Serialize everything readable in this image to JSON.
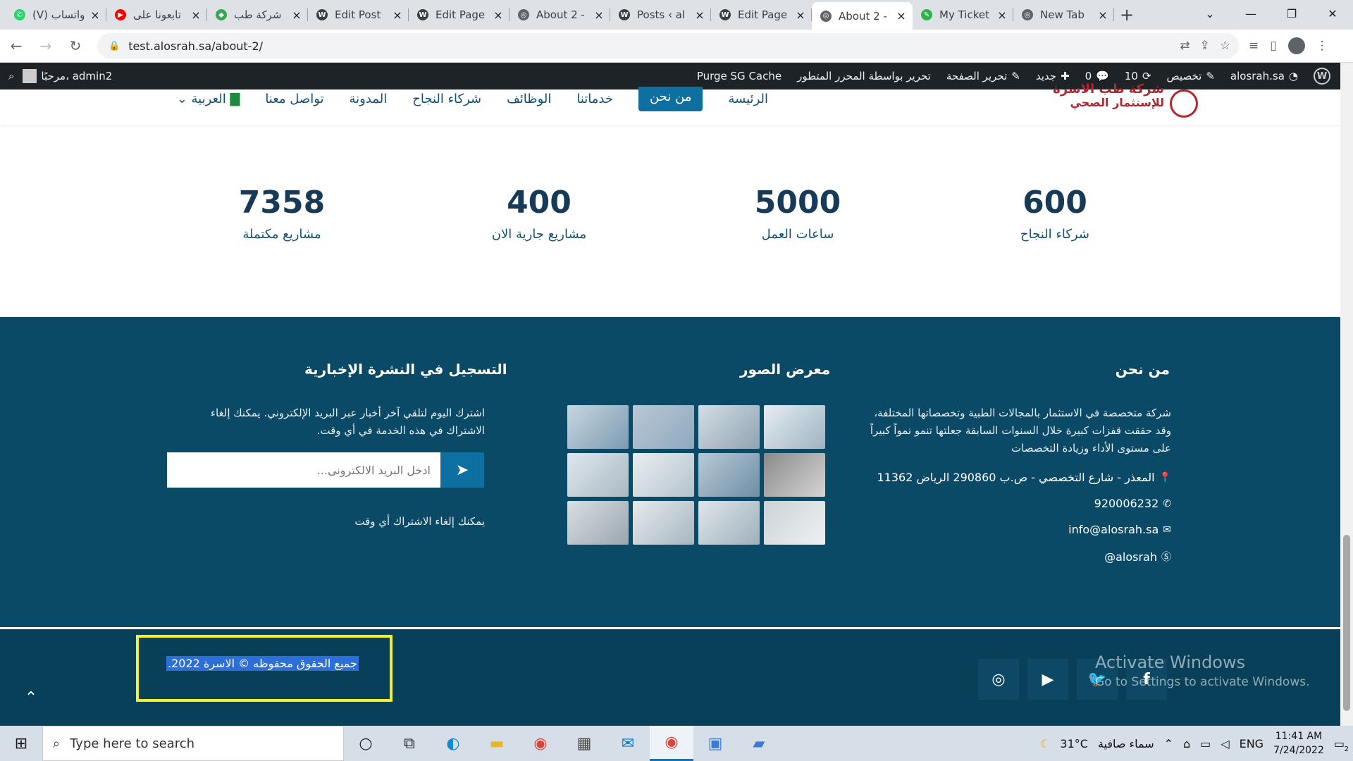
{
  "browser": {
    "tabs": [
      {
        "title": "(V) واتساب",
        "color": "#25d366",
        "glyph": "✆"
      },
      {
        "title": "تابعونا على",
        "color": "#ff0000",
        "glyph": "▶"
      },
      {
        "title": "شركة طب",
        "color": "#34a853",
        "glyph": "◆"
      },
      {
        "title": "Edit Post",
        "color": "#3c4043",
        "glyph": "W"
      },
      {
        "title": "Edit Page",
        "color": "#3c4043",
        "glyph": "W"
      },
      {
        "title": "About 2 -",
        "color": "#5f6368",
        "glyph": "◎"
      },
      {
        "title": "Posts ‹ al",
        "color": "#3c4043",
        "glyph": "W"
      },
      {
        "title": "Edit Page",
        "color": "#3c4043",
        "glyph": "W"
      },
      {
        "title": "About 2 -",
        "color": "#5f6368",
        "glyph": "◎"
      },
      {
        "title": "My Ticket",
        "color": "#2db34a",
        "glyph": "✎"
      },
      {
        "title": "New Tab",
        "color": "#5f6368",
        "glyph": "◎"
      }
    ],
    "active_tab_index": 8,
    "url": "test.alosrah.sa/about-2/"
  },
  "wp_admin_bar": {
    "site_name": "alosrah.sa",
    "customize": "تخصيص",
    "updates": "10",
    "comments": "0",
    "new": "جديد",
    "edit_page": "تحرير الصفحة",
    "edit_advanced": "تحرير بواسطة المحرر المتطور",
    "purge": "Purge SG Cache",
    "greeting": "مرحبًا، admin2"
  },
  "nav": {
    "items": [
      "الرئيسة",
      "من نحن",
      "خدماتنا",
      "الوظائف",
      "شركاء النجاح",
      "المدونة",
      "تواصل معنا"
    ],
    "active": "من نحن",
    "language": "العربية"
  },
  "stats": [
    {
      "number": "600",
      "label": "شركاء النجاح"
    },
    {
      "number": "5000",
      "label": "ساعات العمل"
    },
    {
      "number": "400",
      "label": "مشاريع جارية الان"
    },
    {
      "number": "7358",
      "label": "مشاريع مكتملة"
    }
  ],
  "footer": {
    "about_title": "من نحن",
    "about_text": "شركة متخصصة في الاستثمار بالمجالات الطبية وتخصصاتها المختلفة، وقد حققت قفزات كبيرة خلال السنوات السابقة جعلتها تنمو نمواً كبيراً على مستوى الأداء وزيادة التخصصات",
    "address": "المعذر - شارع التخصصي - ص.ب 290860 الرياض 11362",
    "phone": "920006232",
    "email": "info@alosrah.sa",
    "skype": "alosrah@",
    "gallery_title": "معرض الصور",
    "newsletter_title": "التسجيل في النشرة الإخبارية",
    "newsletter_text": "اشترك اليوم لتلقي آخر أخبار عبر البريد الإلكتروني. يمكنك إلغاء الاشتراك في هذه الخدمة في أي وقت.",
    "email_placeholder": "ادخل البريد الالكترونى...",
    "unsubscribe_note": "يمكنك إلغاء الاشتراك أي وقت",
    "copyright": "جميع الحقوق محفوظه © الاسرة 2022."
  },
  "windows_watermark": {
    "line1": "Activate Windows",
    "line2": "Go to Settings to activate Windows."
  },
  "taskbar": {
    "search_placeholder": "Type here to search",
    "weather_temp": "31°C",
    "weather_text": "سماء صافية",
    "language": "ENG",
    "time": "11:41 AM",
    "date": "7/24/2022",
    "notifications": "2"
  },
  "colors": {
    "brand_blue": "#0f5173",
    "footer_bg": "#0b4a66",
    "accent": "#0e6fa1",
    "highlight_box": "#f5ef2a"
  }
}
